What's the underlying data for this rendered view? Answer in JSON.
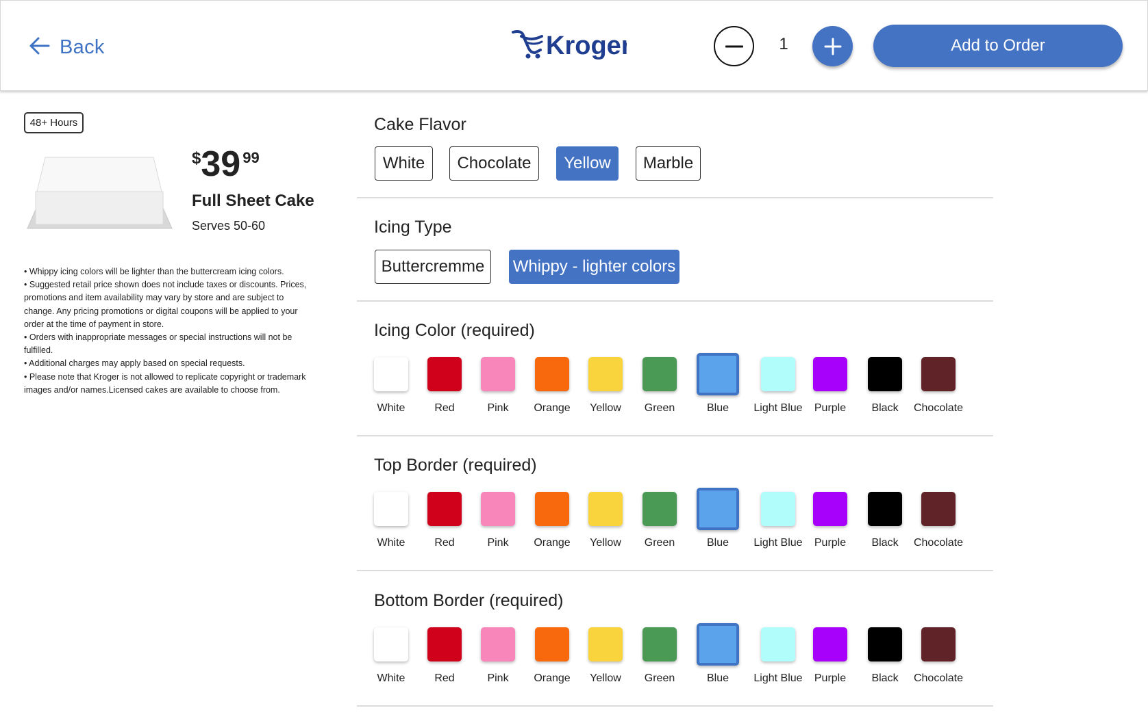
{
  "header": {
    "back_label": "Back",
    "logo_text": "Kroger",
    "quantity": "1",
    "add_to_order_label": "Add to Order"
  },
  "product": {
    "lead_time_badge": "48+ Hours",
    "price_dollar_sign": "$",
    "price_whole": "39",
    "price_cents": "99",
    "name": "Full Sheet Cake",
    "serves": "Serves 50-60",
    "notes": [
      "• Whippy icing colors will be lighter than the buttercream icing colors.",
      "• Suggested retail price shown does not include taxes or discounts. Prices, promotions and item availability may vary by store and are subject to change. Any pricing promotions or digital coupons will be applied to your order at the time of payment in store.",
      "• Orders with inappropriate messages or special instructions will not be fulfilled.",
      "• Additional charges may apply based on special requests.",
      "• Please note that Kroger is not allowed to replicate copyright or trademark images and/or names.Licensed cakes are available to choose from."
    ]
  },
  "cake_flavor": {
    "title": "Cake Flavor",
    "options": [
      "White",
      "Chocolate",
      "Yellow",
      "Marble"
    ],
    "selected": "Yellow"
  },
  "icing_type": {
    "title": "Icing Type",
    "options": [
      "Buttercremme",
      "Whippy - lighter colors"
    ],
    "selected": "Whippy - lighter colors"
  },
  "colors": [
    {
      "label": "White",
      "hex": "#ffffff"
    },
    {
      "label": "Red",
      "hex": "#d0021b"
    },
    {
      "label": "Pink",
      "hex": "#f886bb"
    },
    {
      "label": "Orange",
      "hex": "#f7690c"
    },
    {
      "label": "Yellow",
      "hex": "#fad43d"
    },
    {
      "label": "Green",
      "hex": "#4a9a55"
    },
    {
      "label": "Blue",
      "hex": "#5ba4ec"
    },
    {
      "label": "Light Blue",
      "hex": "#b0fdfb"
    },
    {
      "label": "Purple",
      "hex": "#a801fb"
    },
    {
      "label": "Black",
      "hex": "#000000"
    },
    {
      "label": "Chocolate",
      "hex": "#602428"
    }
  ],
  "icing_color": {
    "title": "Icing Color (required)",
    "selected": "Blue"
  },
  "top_border": {
    "title": "Top Border (required)",
    "selected": "Blue"
  },
  "bottom_border": {
    "title": "Bottom Border (required)",
    "selected": "Blue"
  },
  "theme": {
    "accent": "#4473c4"
  }
}
